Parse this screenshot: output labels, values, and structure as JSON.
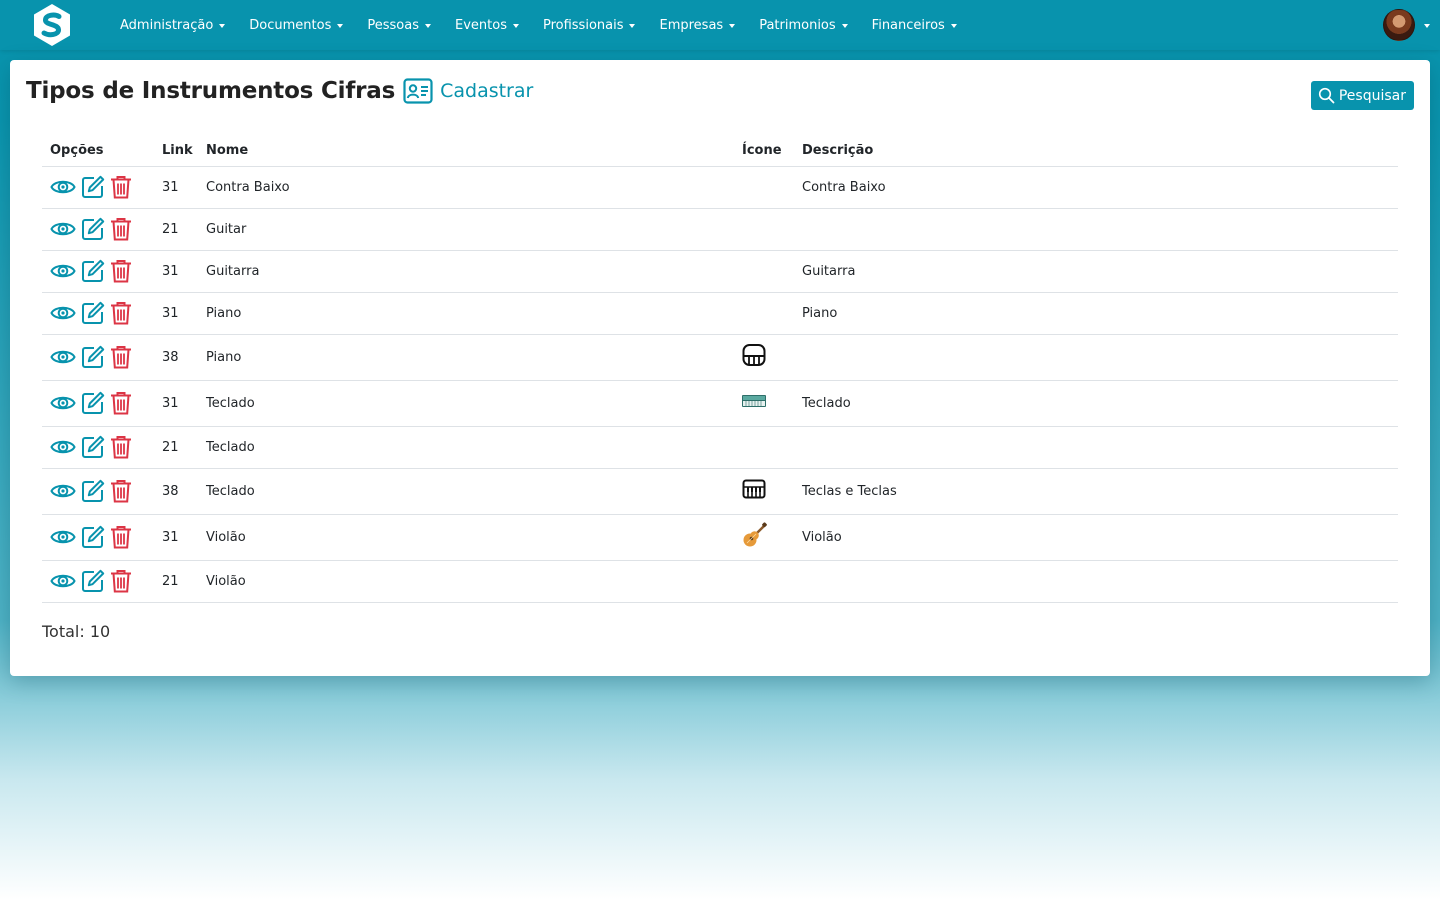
{
  "nav": {
    "items": [
      {
        "label": "Administração"
      },
      {
        "label": "Documentos"
      },
      {
        "label": "Pessoas"
      },
      {
        "label": "Eventos"
      },
      {
        "label": "Profissionais"
      },
      {
        "label": "Empresas"
      },
      {
        "label": "Patrimonios"
      },
      {
        "label": "Financeiros"
      }
    ]
  },
  "page": {
    "title": "Tipos de Instrumentos Cifras",
    "register_label": "Cadastrar",
    "search_label": "Pesquisar"
  },
  "table": {
    "headers": {
      "options": "Opções",
      "link": "Link",
      "name": "Nome",
      "icon": "Ícone",
      "description": "Descrição"
    },
    "rows": [
      {
        "link": "31",
        "name": "Contra Baixo",
        "icon": "",
        "description": "Contra Baixo"
      },
      {
        "link": "21",
        "name": "Guitar",
        "icon": "",
        "description": ""
      },
      {
        "link": "31",
        "name": "Guitarra",
        "icon": "",
        "description": "Guitarra"
      },
      {
        "link": "31",
        "name": "Piano",
        "icon": "",
        "description": "Piano"
      },
      {
        "link": "38",
        "name": "Piano",
        "icon": "piano-icon",
        "description": ""
      },
      {
        "link": "31",
        "name": "Teclado",
        "icon": "keyboard-image-icon",
        "description": "Teclado"
      },
      {
        "link": "21",
        "name": "Teclado",
        "icon": "",
        "description": ""
      },
      {
        "link": "38",
        "name": "Teclado",
        "icon": "keyboard-icon",
        "description": "Teclas e Teclas"
      },
      {
        "link": "31",
        "name": "Violão",
        "icon": "guitar-emoji-icon",
        "description": "Violão"
      },
      {
        "link": "21",
        "name": "Violão",
        "icon": "",
        "description": ""
      }
    ]
  },
  "footer": {
    "total_label": "Total: 10"
  },
  "colors": {
    "primary": "#0893ad",
    "danger": "#dc3545",
    "text": "#212529"
  }
}
